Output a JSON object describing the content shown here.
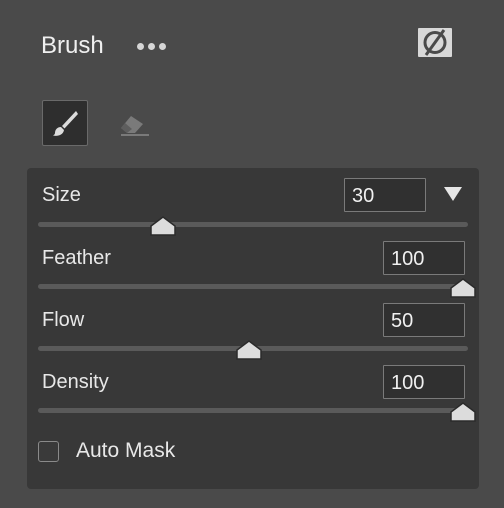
{
  "header": {
    "title": "Brush",
    "more_icon": "more-horizontal-icon",
    "toggle_icon": "visibility-toggle-icon"
  },
  "tools": [
    {
      "name": "brush-tool",
      "icon": "brush-icon",
      "selected": true
    },
    {
      "name": "eraser-tool",
      "icon": "eraser-icon",
      "selected": false
    }
  ],
  "sliders": {
    "size": {
      "label": "Size",
      "value": "30",
      "level": 0.3,
      "dropdown_icon": "triangle-down-icon"
    },
    "feather": {
      "label": "Feather",
      "value": "100",
      "level": 1.0
    },
    "flow": {
      "label": "Flow",
      "value": "50",
      "level": 0.5
    },
    "density": {
      "label": "Density",
      "value": "100",
      "level": 1.0
    }
  },
  "auto_mask": {
    "label": "Auto Mask",
    "checked": false
  },
  "colors": {
    "background": "#4a4a4a",
    "panel": "#383838",
    "thumb": "#dcdcdc"
  }
}
